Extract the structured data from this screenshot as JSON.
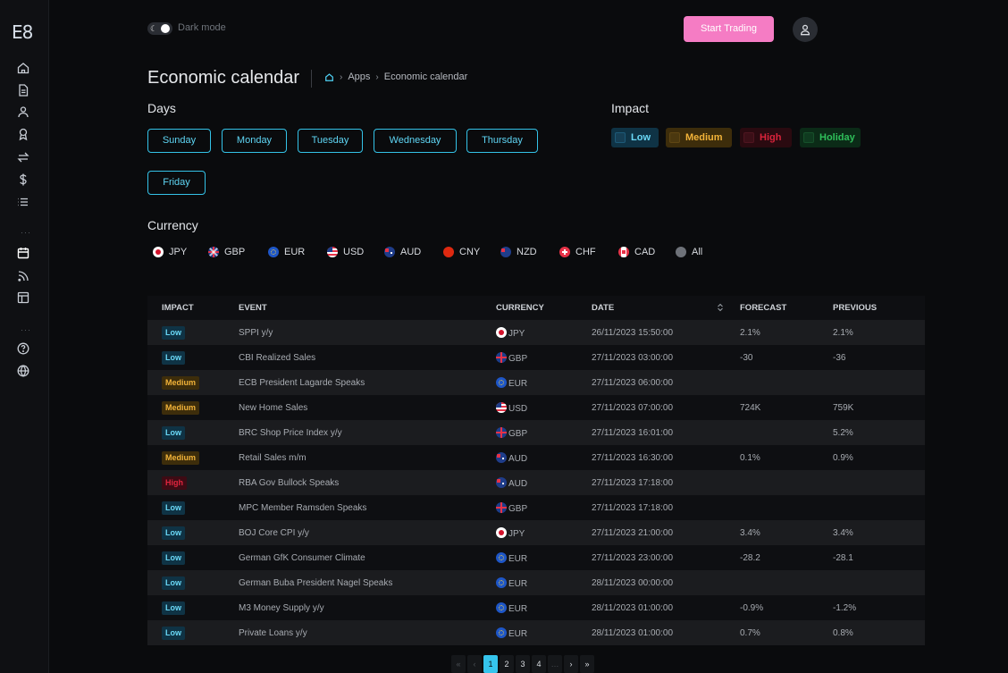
{
  "app": {
    "logo": "E8"
  },
  "topbar": {
    "dark_mode_label": "Dark mode",
    "start_trading_label": "Start Trading"
  },
  "header": {
    "title": "Economic calendar",
    "breadcrumb": [
      "Apps",
      "Economic calendar"
    ]
  },
  "days": {
    "label": "Days",
    "items": [
      "Sunday",
      "Monday",
      "Tuesday",
      "Wednesday",
      "Thursday",
      "Friday"
    ]
  },
  "impact": {
    "label": "Impact",
    "items": [
      {
        "label": "Low",
        "color": "#35c4ec"
      },
      {
        "label": "Medium",
        "color": "#f2b339"
      },
      {
        "label": "High",
        "color": "#e0263f"
      },
      {
        "label": "Holiday",
        "color": "#2fbf5a"
      }
    ]
  },
  "currency": {
    "label": "Currency",
    "items": [
      "JPY",
      "GBP",
      "EUR",
      "USD",
      "AUD",
      "CNY",
      "NZD",
      "CHF",
      "CAD",
      "All"
    ]
  },
  "table": {
    "headers": [
      "IMPACT",
      "EVENT",
      "CURRENCY",
      "DATE",
      "FORECAST",
      "PREVIOUS"
    ],
    "rows": [
      {
        "impact": "Low",
        "event": "SPPI y/y",
        "currency": "JPY",
        "date": "26/11/2023 15:50:00",
        "forecast": "2.1%",
        "previous": "2.1%"
      },
      {
        "impact": "Low",
        "event": "CBI Realized Sales",
        "currency": "GBP",
        "date": "27/11/2023 03:00:00",
        "forecast": "-30",
        "previous": "-36"
      },
      {
        "impact": "Medium",
        "event": "ECB President Lagarde Speaks",
        "currency": "EUR",
        "date": "27/11/2023 06:00:00",
        "forecast": "",
        "previous": ""
      },
      {
        "impact": "Medium",
        "event": "New Home Sales",
        "currency": "USD",
        "date": "27/11/2023 07:00:00",
        "forecast": "724K",
        "previous": "759K"
      },
      {
        "impact": "Low",
        "event": "BRC Shop Price Index y/y",
        "currency": "GBP",
        "date": "27/11/2023 16:01:00",
        "forecast": "",
        "previous": "5.2%"
      },
      {
        "impact": "Medium",
        "event": "Retail Sales m/m",
        "currency": "AUD",
        "date": "27/11/2023 16:30:00",
        "forecast": "0.1%",
        "previous": "0.9%"
      },
      {
        "impact": "High",
        "event": "RBA Gov Bullock Speaks",
        "currency": "AUD",
        "date": "27/11/2023 17:18:00",
        "forecast": "",
        "previous": ""
      },
      {
        "impact": "Low",
        "event": "MPC Member Ramsden Speaks",
        "currency": "GBP",
        "date": "27/11/2023 17:18:00",
        "forecast": "",
        "previous": ""
      },
      {
        "impact": "Low",
        "event": "BOJ Core CPI y/y",
        "currency": "JPY",
        "date": "27/11/2023 21:00:00",
        "forecast": "3.4%",
        "previous": "3.4%"
      },
      {
        "impact": "Low",
        "event": "German GfK Consumer Climate",
        "currency": "EUR",
        "date": "27/11/2023 23:00:00",
        "forecast": "-28.2",
        "previous": "-28.1"
      },
      {
        "impact": "Low",
        "event": "German Buba President Nagel Speaks",
        "currency": "EUR",
        "date": "28/11/2023 00:00:00",
        "forecast": "",
        "previous": ""
      },
      {
        "impact": "Low",
        "event": "M3 Money Supply y/y",
        "currency": "EUR",
        "date": "28/11/2023 01:00:00",
        "forecast": "-0.9%",
        "previous": "-1.2%"
      },
      {
        "impact": "Low",
        "event": "Private Loans y/y",
        "currency": "EUR",
        "date": "28/11/2023 01:00:00",
        "forecast": "0.7%",
        "previous": "0.8%"
      }
    ]
  },
  "pagination": {
    "first": "«",
    "prev": "‹",
    "pages": [
      "1",
      "2",
      "3",
      "4"
    ],
    "ellipsis": "…",
    "next": "›",
    "last": "»",
    "current": "1"
  },
  "sidebar": {
    "icons": [
      "home-icon",
      "document-icon",
      "user-icon",
      "award-icon",
      "exchange-icon",
      "dollar-icon",
      "list-icon",
      "calendar-icon",
      "rss-icon",
      "layout-icon",
      "help-icon",
      "globe-icon"
    ]
  }
}
